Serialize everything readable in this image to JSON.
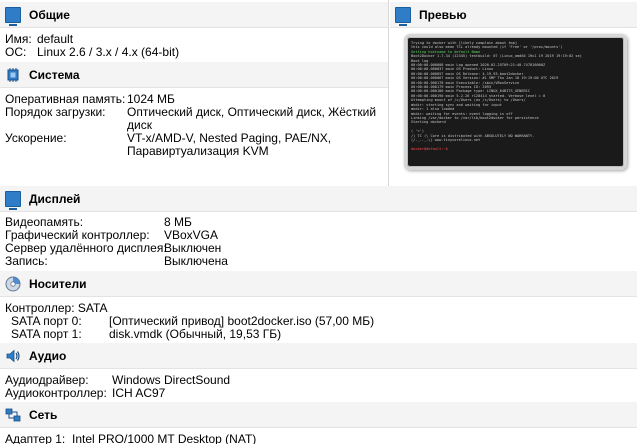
{
  "general": {
    "title": "Общие",
    "name_label": "Имя:",
    "name_value": "default",
    "os_label": "ОС:",
    "os_value": "Linux 2.6 / 3.x / 4.x (64-bit)"
  },
  "preview": {
    "title": "Превью",
    "terminal_lines": [
      "Trying to docker with [likely complain about tmp]",
      "  this could also mean TCL already mounted (if 'Free' or '/proc/mounts')",
      "Setting hostname to default Name",
      "Boot2Docker 1.7.34 (12345) testbuild: 07 (Linux_amd64 19x1 19 2019 19:19:02 se)",
      "Boot log",
      "00:00:00.000008 main     Log opened 2020-02-25T09:21:40.747816000Z",
      "00:00:00.000037 main     OS Product: Linux",
      "00:00:00.000057 main     OS Release: 4.19.93-boot2docker",
      "00:00:00.000067 main     OS Version: #1 SMP Thu Jan 10 19:19:00 UTC 2019",
      "00:00:00.000178 main     Executable: /sbin/VBoxService",
      "00:00:00.000179 main     Process ID: 2093",
      "00:00:00.000180 main     Package type: LINUX_64BITS_GENERIC",
      "00:00:00.000190 main     5.2.26 r128414 started. Verbose level = 0",
      "Attempting mount of /c/Users (as /c/Users) to /Users/",
      "mkdir: starting sync and waiting for input",
      "mkdir: 1 also loaded",
      "mkdir: waiting for events: event logging is off",
      "Linking /var/docker to /var/lib/boot2docker for persistence",
      "Starting dockerd",
      "",
      "   ( '>')",
      "  /) TC (\\   Core is distributed with ABSOLUTELY NO WARRANTY.",
      " (/-_--_-\\)           www.tinycorelinux.net",
      "",
      "docker@default:~$"
    ]
  },
  "system": {
    "title": "Система",
    "ram_label": "Оперативная память:",
    "ram_value": "1024 МБ",
    "boot_label": "Порядок загрузки:",
    "boot_value_1": "Оптический диск, Оптический диск, Жёсткий",
    "boot_value_2": "диск",
    "accel_label": "Ускорение:",
    "accel_value_1": "VT-x/AMD-V, Nested Paging, PAE/NX,",
    "accel_value_2": "Паравиртуализация KVM"
  },
  "display": {
    "title": "Дисплей",
    "vram_label": "Видеопамять:",
    "vram_value": "8 МБ",
    "controller_label": "Графический контроллер:",
    "controller_value": "VBoxVGA",
    "rdp_label": "Сервер удалённого дисплея:",
    "rdp_value": "Выключен",
    "record_label": "Запись:",
    "record_value": "Выключена"
  },
  "storage": {
    "title": "Носители",
    "controller_label": "Контроллер: SATA",
    "port0_label": "SATA порт 0:",
    "port0_value": "[Оптический привод] boot2docker.iso (57,00 МБ)",
    "port1_label": "SATA порт 1:",
    "port1_value": "disk.vmdk (Обычный, 19,53 ГБ)"
  },
  "audio": {
    "title": "Аудио",
    "driver_label": "Аудиодрайвер:",
    "driver_value": "Windows DirectSound",
    "controller_label": "Аудиоконтроллер:",
    "controller_value": "ICH AC97"
  },
  "network": {
    "title": "Сеть",
    "adapter1_label": "Адаптер 1:",
    "adapter1_value": "Intel PRO/1000 MT Desktop (NAT)"
  },
  "colors": {
    "header_bg": "#f4f4f4",
    "icon_blue": "#2f7dc6",
    "terminal_bg": "#1a1a1a",
    "terminal_green": "#59d65e"
  }
}
